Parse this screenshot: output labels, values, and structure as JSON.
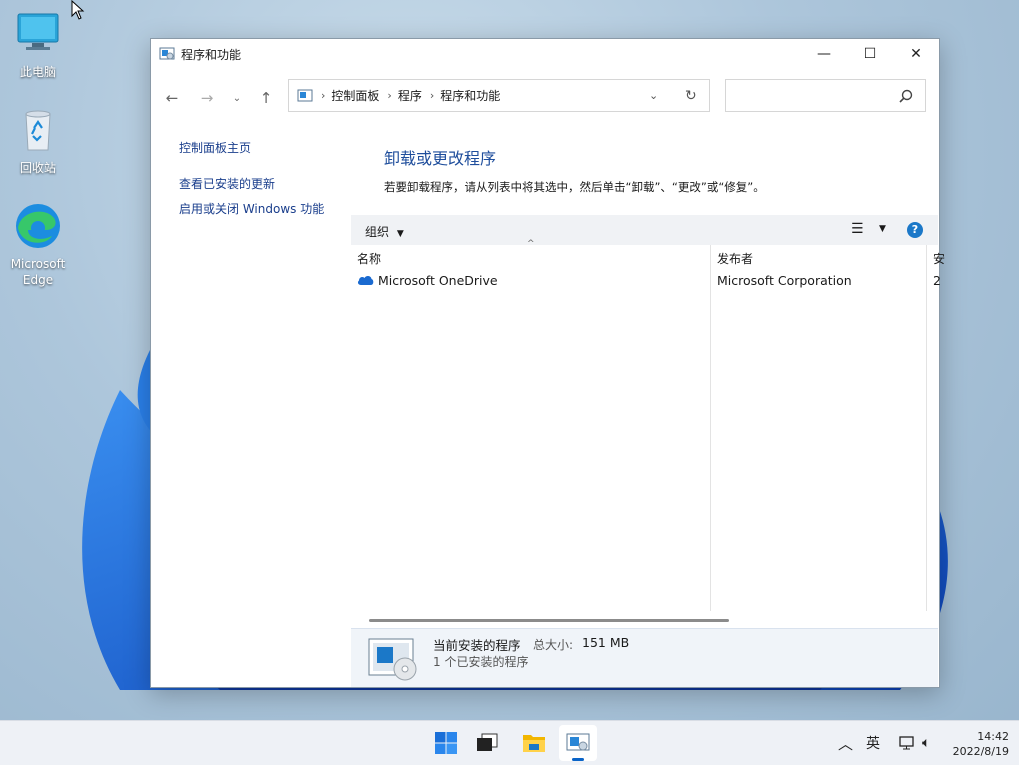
{
  "desktop": {
    "icons": [
      {
        "label": "此电脑",
        "icon": "computer-icon"
      },
      {
        "label": "回收站",
        "icon": "recycle-bin-icon"
      },
      {
        "label": "Microsoft Edge",
        "icon": "edge-icon"
      }
    ]
  },
  "window": {
    "title": "程序和功能",
    "controls": {
      "minimize": "—",
      "maximize": "☐",
      "close": "✕"
    }
  },
  "nav": {
    "breadcrumb": [
      "控制面板",
      "程序",
      "程序和功能"
    ],
    "search_placeholder": ""
  },
  "sidebar": {
    "items": [
      {
        "label": "控制面板主页"
      },
      {
        "label": "查看已安装的更新"
      },
      {
        "label": "启用或关闭 Windows 功能"
      }
    ]
  },
  "main": {
    "heading": "卸载或更改程序",
    "description": "若要卸载程序，请从列表中将其选中，然后单击“卸载”、“更改”或“修复”。",
    "toolbar": {
      "organize": "组织"
    },
    "columns": [
      "名称",
      "发布者",
      "安"
    ],
    "rows": [
      {
        "name": "Microsoft OneDrive",
        "publisher": "Microsoft Corporation",
        "extra": "2"
      }
    ]
  },
  "details": {
    "title": "当前安装的程序",
    "size_label": "总大小:",
    "size_value": "151 MB",
    "count": "1 个已安装的程序"
  },
  "taskbar": {
    "apps": [
      "start-icon",
      "task-view-icon",
      "file-explorer-icon",
      "control-panel-icon"
    ],
    "ime": "英",
    "time": "14:42",
    "date": "2022/8/19"
  },
  "colors": {
    "link": "#1a3e8c",
    "heading": "#1f4e9c",
    "help": "#1b78c8",
    "accent": "#0a64c8"
  }
}
